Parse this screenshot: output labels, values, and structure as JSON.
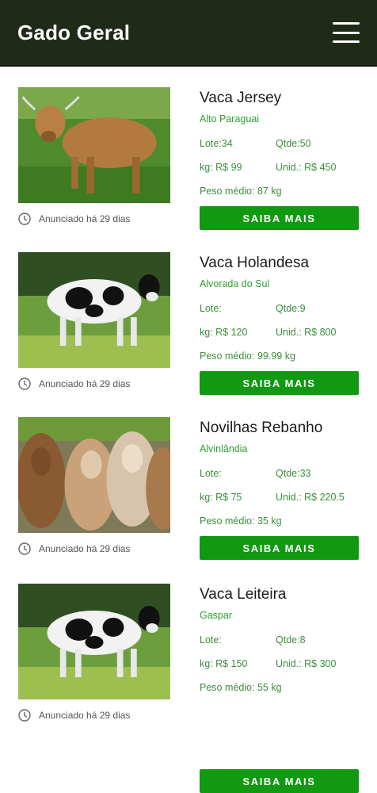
{
  "app": {
    "title": "Gado Geral"
  },
  "listings": [
    {
      "name": "Vaca Jersey",
      "city": "Alto Paraguai",
      "lote": "Lote:34",
      "qtde": "Qtde:50",
      "kg": "kg: R$ 99",
      "unid": "Unid.: R$ 450",
      "peso": "Peso médio: 87 kg",
      "posted": "Anunciado há 29 dias",
      "button": "SAIBA MAIS",
      "image": "jersey-cow-photo"
    },
    {
      "name": "Vaca Holandesa",
      "city": "Alvorada do Sul",
      "lote": "Lote:",
      "qtde": "Qtde:9",
      "kg": "kg: R$ 120",
      "unid": "Unid.: R$ 800",
      "peso": "Peso médio: 99.99 kg",
      "posted": "Anunciado há 29 dias",
      "button": "SAIBA MAIS",
      "image": "holstein-cow-photo"
    },
    {
      "name": "Novilhas Rebanho",
      "city": "Alvinlândia",
      "lote": "Lote:",
      "qtde": "Qtde:33",
      "kg": "kg: R$ 75",
      "unid": "Unid.: R$ 220.5",
      "peso": "Peso médio: 35 kg",
      "posted": "Anunciado há 29 dias",
      "button": "SAIBA MAIS",
      "image": "heifer-herd-photo"
    },
    {
      "name": "Vaca Leiteira",
      "city": "Gaspar",
      "lote": "Lote:",
      "qtde": "Qtde:8",
      "kg": "kg: R$ 150",
      "unid": "Unid.: R$ 300",
      "peso": "Peso médio: 55 kg",
      "posted": "Anunciado há 29 dias",
      "button": "SAIBA MAIS",
      "image": "holstein-cow-photo"
    }
  ],
  "colors": {
    "appbar": "#1f2a17",
    "button": "#119911",
    "accent_text": "#2f9e2f"
  },
  "icons": {
    "menu": "hamburger-menu-icon",
    "clock": "clock-icon"
  }
}
